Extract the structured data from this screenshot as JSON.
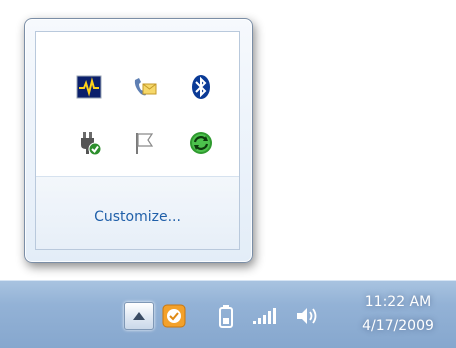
{
  "notification_overflow": {
    "icons_row1": [
      "performance-monitor-icon",
      "phone-mail-icon",
      "bluetooth-icon"
    ],
    "icons_row2": [
      "usb-device-icon",
      "action-center-flag-icon",
      "sync-center-icon"
    ],
    "customize_label": "Customize..."
  },
  "taskbar": {
    "show_hidden_icon": "up-arrow-icon",
    "tray_icons": [
      "orange-app-icon",
      "battery-icon",
      "network-signal-icon",
      "volume-icon"
    ],
    "clock": {
      "time": "11:22 AM",
      "date": "4/17/2009"
    }
  },
  "colors": {
    "taskbar": "#93b2d6",
    "link": "#1f5fa9",
    "flyout_border": "#7b8ea6"
  }
}
